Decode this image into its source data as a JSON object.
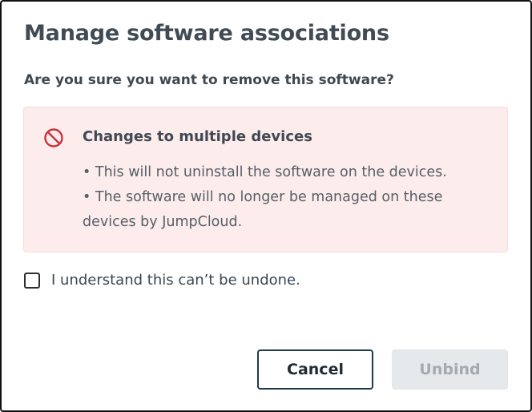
{
  "dialog": {
    "title": "Manage software associations",
    "question": "Are you sure you want to remove this software?"
  },
  "alert": {
    "icon": "prohibited-icon",
    "icon_color": "#c8323c",
    "background_color": "#fdecec",
    "title": "Changes to multiple devices",
    "items": [
      "This will not uninstall the software on the devices.",
      "The software will no longer be managed on these devices by JumpCloud."
    ]
  },
  "confirm": {
    "checked": false,
    "label": "I understand this can’t be undone."
  },
  "buttons": {
    "cancel_label": "Cancel",
    "unbind_label": "Unbind",
    "unbind_disabled": true
  }
}
